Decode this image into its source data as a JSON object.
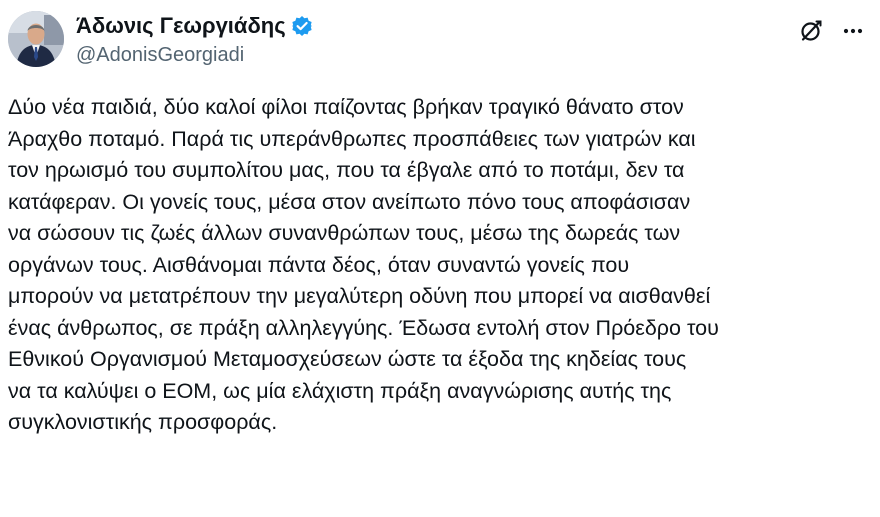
{
  "author": {
    "display_name": "Άδωνις Γεωργιάδης",
    "handle": "@AdonisGeorgiadi",
    "verified": true,
    "verified_badge_color": "#1d9bf0",
    "avatar_icon": "profile-photo"
  },
  "actions": {
    "grok_icon": "grok-icon",
    "more_icon": "more-icon"
  },
  "tweet": {
    "text": "Δύο νέα παιδιά, δύο καλοί φίλοι παίζοντας  βρήκαν τραγικό θάνατο στον\nΆραχθο ποταμό. Παρά τις υπεράνθρωπες προσπάθειες των γιατρών και\nτον ηρωισμό του συμπολίτου μας, που τα έβγαλε από το ποτάμι, δεν τα\nκατάφεραν. Οι γονείς τους, μέσα στον ανείπωτο πόνο τους αποφάσισαν\nνα σώσουν τις ζωές άλλων συνανθρώπων τους, μέσω της δωρεάς των\nοργάνων τους. Αισθάνομαι πάντα δέος, όταν συναντώ γονείς που\nμπορούν να μετατρέπουν την μεγαλύτερη οδύνη που μπορεί να αισθανθεί\nένας άνθρωπος, σε πράξη αλληλεγγύης. Έδωσα εντολή στον Πρόεδρο του\nΕθνικού Οργανισμού Μεταμοσχεύσεων ώστε τα έξοδα της κηδείας τους\nνα τα καλύψει ο ΕΟΜ, ως μία ελάχιστη πράξη αναγνώρισης αυτής της\nσυγκλονιστικής προσφοράς."
  }
}
